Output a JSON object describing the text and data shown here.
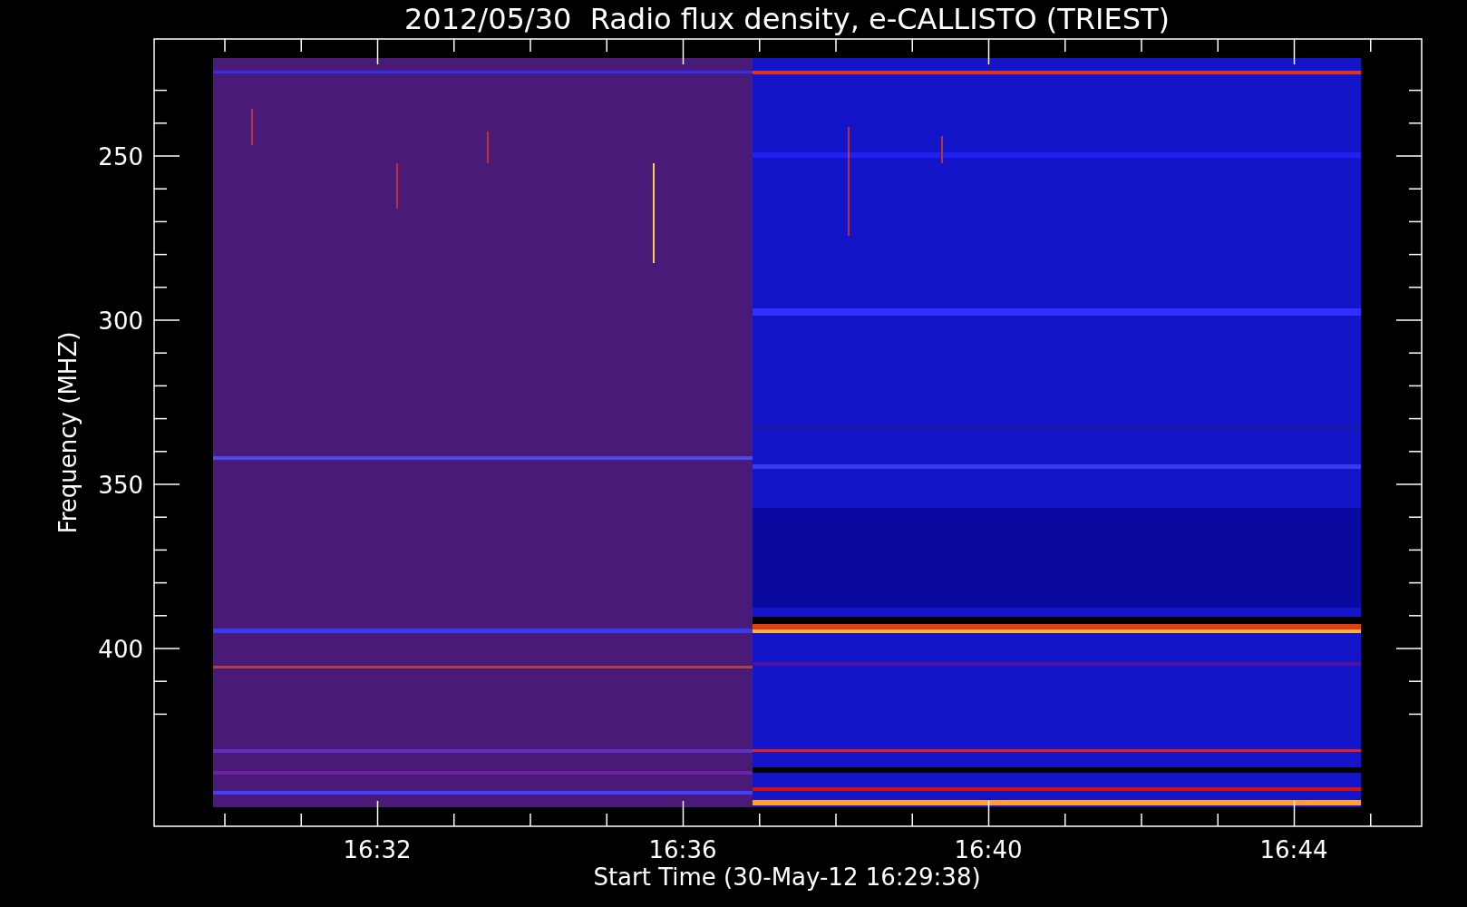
{
  "title": "2012/05/30  Radio flux density, e-CALLISTO (TRIEST)",
  "y_axis": {
    "label": "Frequency (MHZ)",
    "ticks": [
      "250",
      "300",
      "350",
      "400"
    ]
  },
  "x_axis": {
    "label": "Start Time (30-May-12 16:29:38)",
    "ticks": [
      "16:32",
      "16:36",
      "16:40",
      "16:44"
    ]
  }
}
